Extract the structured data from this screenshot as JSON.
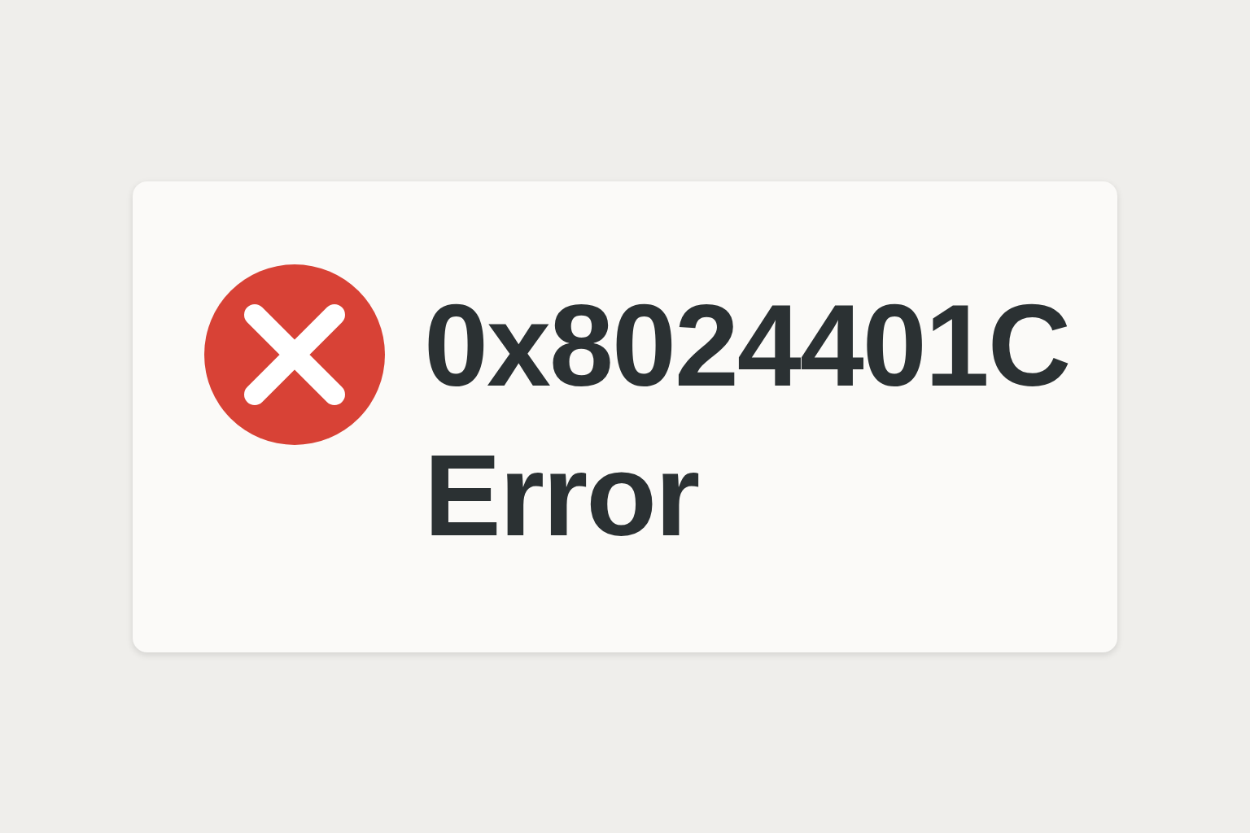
{
  "dialog": {
    "kind": "error",
    "code": "0x8024401C",
    "message": "Error"
  }
}
